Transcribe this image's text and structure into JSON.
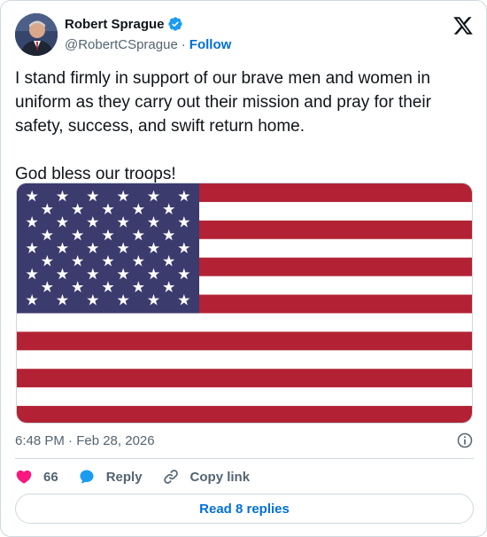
{
  "author": {
    "display_name": "Robert Sprague",
    "handle": "@RobertCSprague",
    "separator": "·",
    "follow_label": "Follow",
    "verified": true
  },
  "tweet": {
    "text": "I stand firmly in support of our brave men and women in uniform as they carry out their mission and pray for their safety, success, and swift return home.\n\nGod bless our troops!",
    "timestamp": "6:48 PM · Feb 28, 2026"
  },
  "media": {
    "kind": "flag-image",
    "icon": "us-flag",
    "colors": {
      "red": "#b22234",
      "white": "#ffffff",
      "blue": "#3c3b6e"
    }
  },
  "actions": {
    "likes_count": "66",
    "reply_label": "Reply",
    "copy_link_label": "Copy link"
  },
  "read_replies_label": "Read 8 replies",
  "colors": {
    "accent": "#006fd6",
    "like": "#f91880",
    "reply_icon": "#1d9bf0",
    "secondary_text": "#536471",
    "border": "#cfd9de"
  }
}
